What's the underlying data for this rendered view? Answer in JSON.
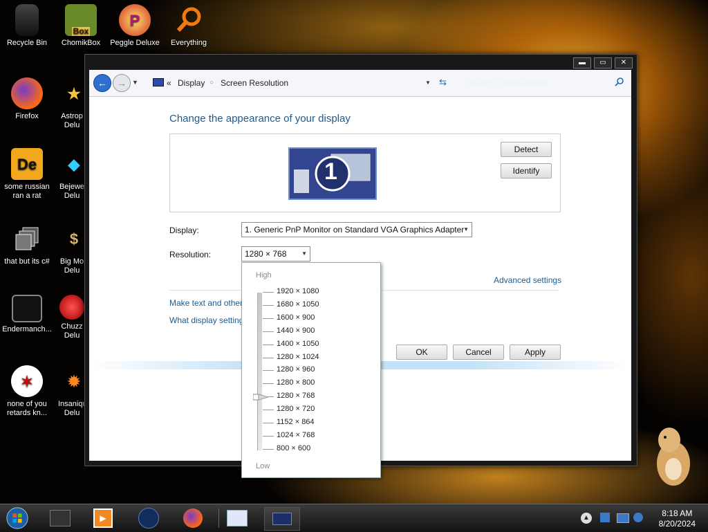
{
  "desktop": {
    "icons": [
      {
        "label": "Recycle Bin"
      },
      {
        "label": "ChomikBox"
      },
      {
        "label": "Peggle Deluxe"
      },
      {
        "label": "Everything"
      },
      {
        "label": "Firefox"
      },
      {
        "label": "Astrop Delu"
      },
      {
        "label": "some russian ran a rat"
      },
      {
        "label": "Bejewe Delu"
      },
      {
        "label": "that but its c#"
      },
      {
        "label": "Big Mo Delu"
      },
      {
        "label": "Endermanch..."
      },
      {
        "label": "Chuzz Delu"
      },
      {
        "label": "none of you retards kn..."
      },
      {
        "label": "Insaniqu Delu"
      }
    ],
    "chomikbox_badge": "Box"
  },
  "window": {
    "breadcrumb": {
      "chevron": "«",
      "display": "Display",
      "separator": "○",
      "current": "Screen Resolution"
    },
    "search_placeholder": "Search Control Panel",
    "heading": "Change the appearance of your display",
    "monitor_number": "1",
    "detect_label": "Detect",
    "identify_label": "Identify",
    "display_label": "Display:",
    "display_value": "1. Generic PnP Monitor on Standard VGA Graphics Adapter",
    "resolution_label": "Resolution:",
    "resolution_value": "1280 × 768",
    "advanced_link": "Advanced settings",
    "link_text_size": "Make text and other",
    "link_display_settings": "What display setting",
    "ok_label": "OK",
    "cancel_label": "Cancel",
    "apply_label": "Apply"
  },
  "resolution_popup": {
    "high_label": "High",
    "low_label": "Low",
    "options": [
      "1920 × 1080",
      "1680 × 1050",
      "1600 × 900",
      "1440 × 900",
      "1400 × 1050",
      "1280 × 1024",
      "1280 × 960",
      "1280 × 800",
      "1280 × 768",
      "1280 × 720",
      "1152 × 864",
      "1024 × 768",
      "800 × 600"
    ],
    "selected": "1280 × 768"
  },
  "taskbar": {
    "time": "8:18 AM",
    "date": "8/20/2024"
  },
  "colors": {
    "link": "#1e5a8e",
    "accent_blue": "#2f6fcf"
  }
}
